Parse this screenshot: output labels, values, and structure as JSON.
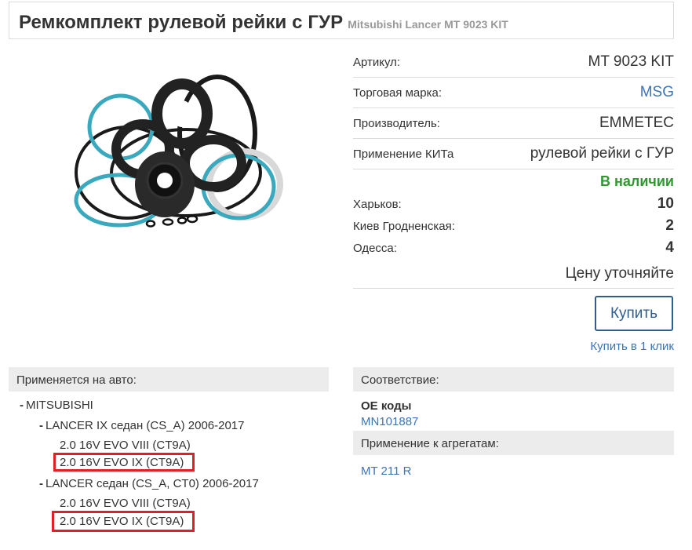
{
  "header": {
    "title": "Ремкомплект рулевой рейки с ГУР",
    "subtitle": "Mitsubishi Lancer MT 9023 KIT"
  },
  "specs": [
    {
      "label": "Артикул:",
      "value": "MT 9023 KIT",
      "is_link": false
    },
    {
      "label": "Торговая марка:",
      "value": "MSG",
      "is_link": true
    },
    {
      "label": "Производитель:",
      "value": "EMMETEC",
      "is_link": false
    },
    {
      "label": "Применение КИТа",
      "value": "рулевой рейки с ГУР",
      "is_link": false
    }
  ],
  "stock": {
    "status": "В наличии",
    "locations": [
      {
        "name": "Харьков:",
        "count": "10"
      },
      {
        "name": "Киев Гродненская:",
        "count": "2"
      },
      {
        "name": "Одесса:",
        "count": "4"
      }
    ],
    "price_note": "Цену уточняйте"
  },
  "actions": {
    "buy_label": "Купить",
    "buy_one_click_label": "Купить в 1 клик"
  },
  "applicability": {
    "header": "Применяется на авто:",
    "make": "MITSUBISHI",
    "models": [
      {
        "name": "LANCER IX седан (CS_A) 2006-2017",
        "variants": [
          "2.0 16V EVO VIII (CT9A)",
          "2.0 16V EVO IX (CT9A)"
        ]
      },
      {
        "name": "LANCER седан (CS_A, CT0) 2006-2017",
        "variants": [
          "2.0 16V EVO VIII (CT9A)",
          "2.0 16V EVO IX (CT9A)"
        ]
      }
    ]
  },
  "correspondence": {
    "header": "Соответствие:",
    "oe_label": "ОЕ коды",
    "oe_code": "MN101887",
    "units_header": "Применение к агрегатам:",
    "unit_link": "MT 211 R"
  },
  "colors": {
    "accent_link": "#3d74b2",
    "button_border": "#2f5d8c",
    "in_stock": "#2e9a2e",
    "highlight": "#e01f26"
  }
}
